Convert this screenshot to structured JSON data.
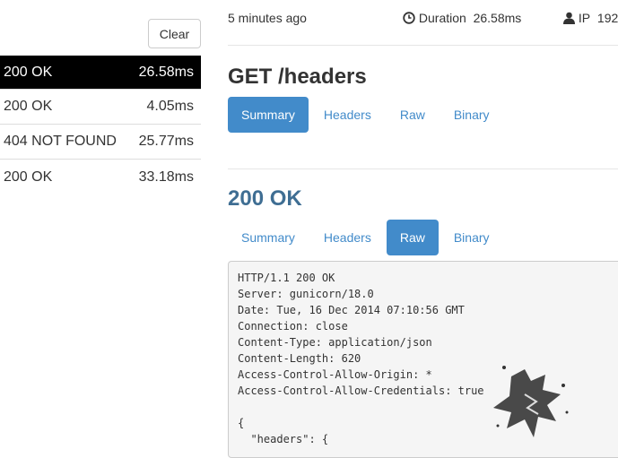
{
  "sidebar": {
    "clear_label": "Clear",
    "requests": [
      {
        "status": "200 OK",
        "duration": "26.58ms",
        "selected": true
      },
      {
        "status": "200 OK",
        "duration": "4.05ms"
      },
      {
        "status": "404 NOT FOUND",
        "duration": "25.77ms"
      },
      {
        "status": "200 OK",
        "duration": "33.18ms"
      }
    ]
  },
  "header": {
    "time": "5 minutes ago",
    "duration_label": "Duration",
    "duration": "26.58ms",
    "ip_label": "IP",
    "ip": "192"
  },
  "request": {
    "title": "GET /headers",
    "tabs": [
      "Summary",
      "Headers",
      "Raw",
      "Binary"
    ],
    "active_tab": "Summary"
  },
  "response": {
    "title": "200 OK",
    "tabs": [
      "Summary",
      "Headers",
      "Raw",
      "Binary"
    ],
    "active_tab": "Raw",
    "raw": "HTTP/1.1 200 OK\nServer: gunicorn/18.0\nDate: Tue, 16 Dec 2014 07:10:56 GMT\nConnection: close\nContent-Type: application/json\nContent-Length: 620\nAccess-Control-Allow-Origin: *\nAccess-Control-Allow-Credentials: true\n\n{\n  \"headers\": {"
  },
  "colors": {
    "accent": "#428bca",
    "selected_row": "#000000",
    "response_title": "#3f6e93"
  }
}
